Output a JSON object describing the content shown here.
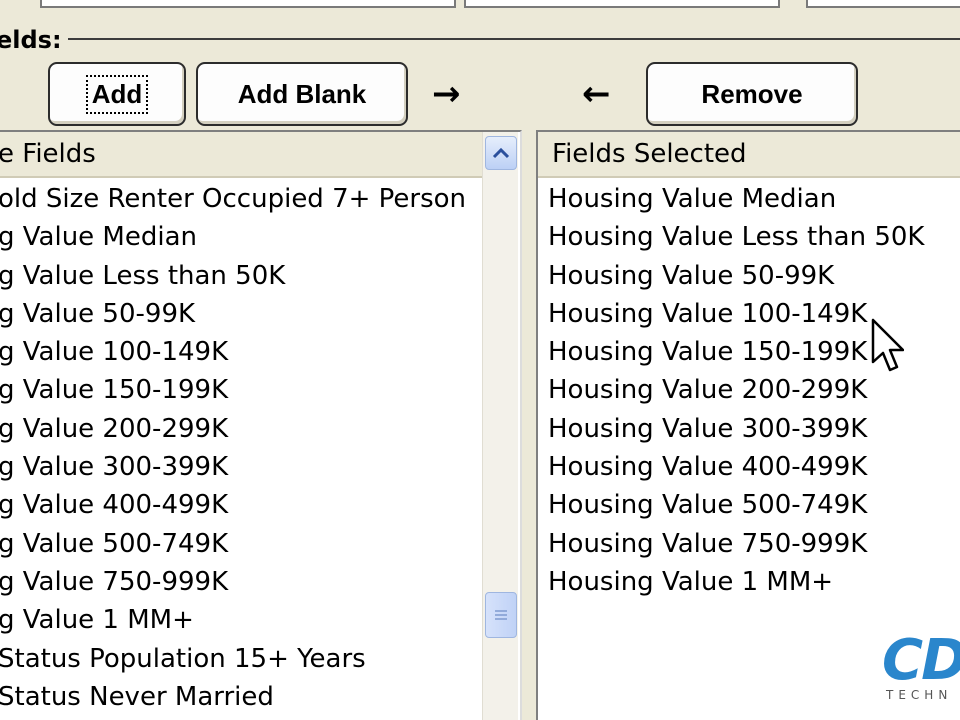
{
  "group": {
    "label": "elds:"
  },
  "buttons": {
    "add": "Add",
    "add_blank": "Add Blank",
    "remove": "Remove",
    "arrow_right": "→",
    "arrow_left": "←"
  },
  "available": {
    "header": "e Fields",
    "items": [
      "old Size Renter Occupied 7+ Person",
      "g Value Median",
      "g Value Less than 50K",
      "g Value 50-99K",
      "g Value 100-149K",
      "g Value 150-199K",
      "g Value 200-299K",
      "g Value 300-399K",
      "g Value 400-499K",
      "g Value 500-749K",
      "g Value 750-999K",
      "g Value 1 MM+",
      "Status Population 15+ Years",
      "Status Never Married"
    ]
  },
  "selected": {
    "header": "Fields Selected",
    "items": [
      "Housing Value Median",
      "Housing Value Less than 50K",
      "Housing Value 50-99K",
      "Housing Value 100-149K",
      "Housing Value 150-199K",
      "Housing Value 200-299K",
      "Housing Value 300-399K",
      "Housing Value 400-499K",
      "Housing Value 500-749K",
      "Housing Value 750-999K",
      "Housing Value 1 MM+"
    ]
  },
  "logo": {
    "main": "CD",
    "sub": "TECHN"
  },
  "icons": {
    "scroll_up": "chevron-up-icon",
    "scroll_grip": "grip-icon",
    "cursor": "mouse-pointer-icon"
  }
}
